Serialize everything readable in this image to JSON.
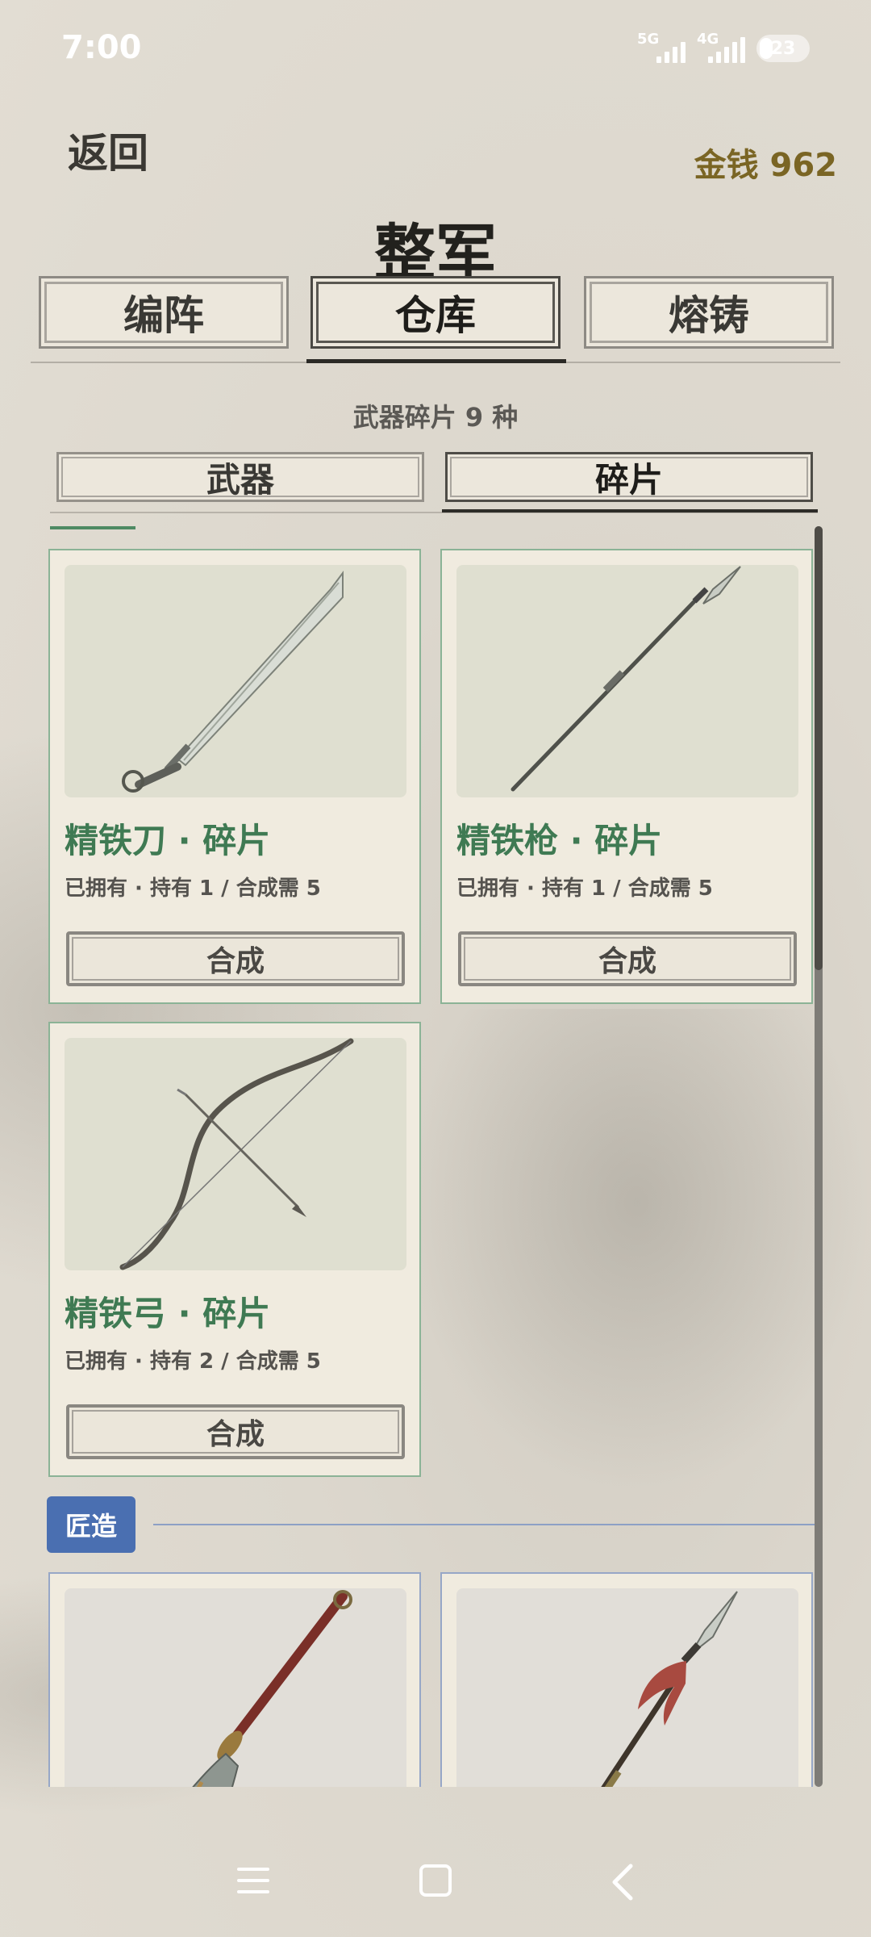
{
  "status": {
    "time": "7:00",
    "net1": "5G",
    "net2": "4G",
    "battery": "23"
  },
  "header": {
    "back_label": "返回",
    "money_label": "金钱 962",
    "title": "整军"
  },
  "tabs": [
    {
      "label": "编阵",
      "active": false
    },
    {
      "label": "仓库",
      "active": true
    },
    {
      "label": "熔铸",
      "active": false
    }
  ],
  "summary": {
    "count_text": "武器碎片 9 种"
  },
  "subtabs": [
    {
      "label": "武器",
      "active": false
    },
    {
      "label": "碎片",
      "active": true
    }
  ],
  "fragments": [
    {
      "name": "精铁刀 · 碎片",
      "detail": "已拥有 · 持有 1 / 合成需 5",
      "button": "合成",
      "icon": "sword-icon"
    },
    {
      "name": "精铁枪 · 碎片",
      "detail": "已拥有 · 持有 1 / 合成需 5",
      "button": "合成",
      "icon": "spear-icon"
    },
    {
      "name": "精铁弓 · 碎片",
      "detail": "已拥有 · 持有 2 / 合成需 5",
      "button": "合成",
      "icon": "bow-icon"
    }
  ],
  "forge": {
    "label": "匠造",
    "items": [
      {
        "icon": "glaive-icon"
      },
      {
        "icon": "red-tassel-spear-icon"
      }
    ]
  },
  "colors": {
    "accent_green": "#3f7a53",
    "forge_blue": "#4a6fb1",
    "money_gold": "#7a6524"
  }
}
